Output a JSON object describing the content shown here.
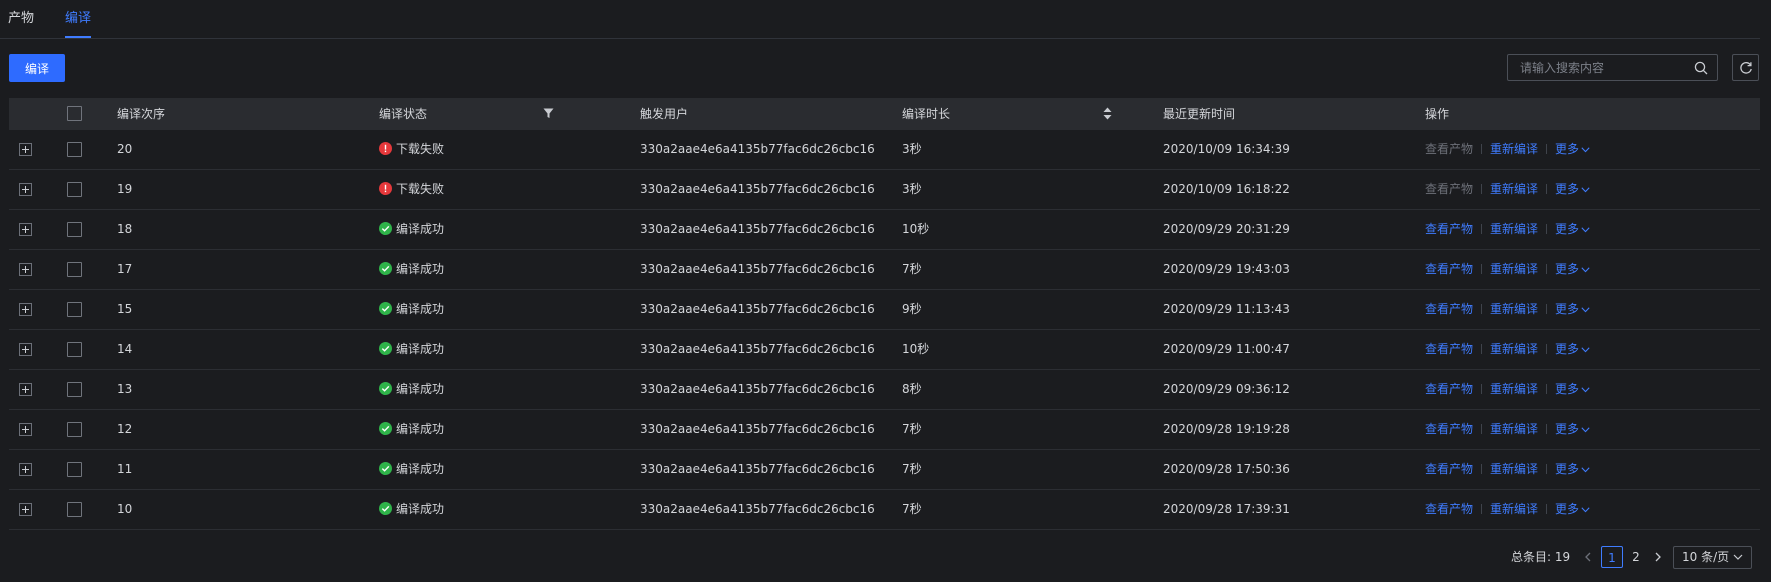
{
  "tabs": [
    {
      "label": "产物",
      "active": false
    },
    {
      "label": "编译",
      "active": true
    }
  ],
  "toolbar": {
    "compile_button": "编译",
    "search_placeholder": "请输入搜索内容"
  },
  "table": {
    "columns": {
      "sequence": "编译次序",
      "status": "编译状态",
      "user": "触发用户",
      "duration": "编译时长",
      "updated": "最近更新时间",
      "actions": "操作"
    },
    "actions": {
      "view": "查看产物",
      "rebuild": "重新编译",
      "more": "更多"
    },
    "rows": [
      {
        "seq": "20",
        "status": "下载失败",
        "status_type": "fail",
        "user": "330a2aae4e6a4135b77fac6dc26cbc16",
        "duration": "3秒",
        "updated": "2020/10/09 16:34:39",
        "view_enabled": false
      },
      {
        "seq": "19",
        "status": "下载失败",
        "status_type": "fail",
        "user": "330a2aae4e6a4135b77fac6dc26cbc16",
        "duration": "3秒",
        "updated": "2020/10/09 16:18:22",
        "view_enabled": false
      },
      {
        "seq": "18",
        "status": "编译成功",
        "status_type": "ok",
        "user": "330a2aae4e6a4135b77fac6dc26cbc16",
        "duration": "10秒",
        "updated": "2020/09/29 20:31:29",
        "view_enabled": true
      },
      {
        "seq": "17",
        "status": "编译成功",
        "status_type": "ok",
        "user": "330a2aae4e6a4135b77fac6dc26cbc16",
        "duration": "7秒",
        "updated": "2020/09/29 19:43:03",
        "view_enabled": true
      },
      {
        "seq": "15",
        "status": "编译成功",
        "status_type": "ok",
        "user": "330a2aae4e6a4135b77fac6dc26cbc16",
        "duration": "9秒",
        "updated": "2020/09/29 11:13:43",
        "view_enabled": true
      },
      {
        "seq": "14",
        "status": "编译成功",
        "status_type": "ok",
        "user": "330a2aae4e6a4135b77fac6dc26cbc16",
        "duration": "10秒",
        "updated": "2020/09/29 11:00:47",
        "view_enabled": true
      },
      {
        "seq": "13",
        "status": "编译成功",
        "status_type": "ok",
        "user": "330a2aae4e6a4135b77fac6dc26cbc16",
        "duration": "8秒",
        "updated": "2020/09/29 09:36:12",
        "view_enabled": true
      },
      {
        "seq": "12",
        "status": "编译成功",
        "status_type": "ok",
        "user": "330a2aae4e6a4135b77fac6dc26cbc16",
        "duration": "7秒",
        "updated": "2020/09/28 19:19:28",
        "view_enabled": true
      },
      {
        "seq": "11",
        "status": "编译成功",
        "status_type": "ok",
        "user": "330a2aae4e6a4135b77fac6dc26cbc16",
        "duration": "7秒",
        "updated": "2020/09/28 17:50:36",
        "view_enabled": true
      },
      {
        "seq": "10",
        "status": "编译成功",
        "status_type": "ok",
        "user": "330a2aae4e6a4135b77fac6dc26cbc16",
        "duration": "7秒",
        "updated": "2020/09/28 17:39:31",
        "view_enabled": true
      }
    ]
  },
  "pagination": {
    "total_label": "总条目: 19",
    "pages": [
      "1",
      "2"
    ],
    "current_page": "1",
    "page_size": "10 条/页"
  },
  "colors": {
    "accent": "#3f7cff",
    "success": "#2fb34a",
    "error": "#e5383b",
    "background": "#1b1c1f",
    "header_bg": "#2a2c30"
  },
  "icons": {
    "search": "search-icon",
    "refresh": "refresh-icon",
    "filter": "filter-icon",
    "sort": "sort-icon",
    "expand": "plus-icon",
    "more": "chevron-down-icon"
  }
}
